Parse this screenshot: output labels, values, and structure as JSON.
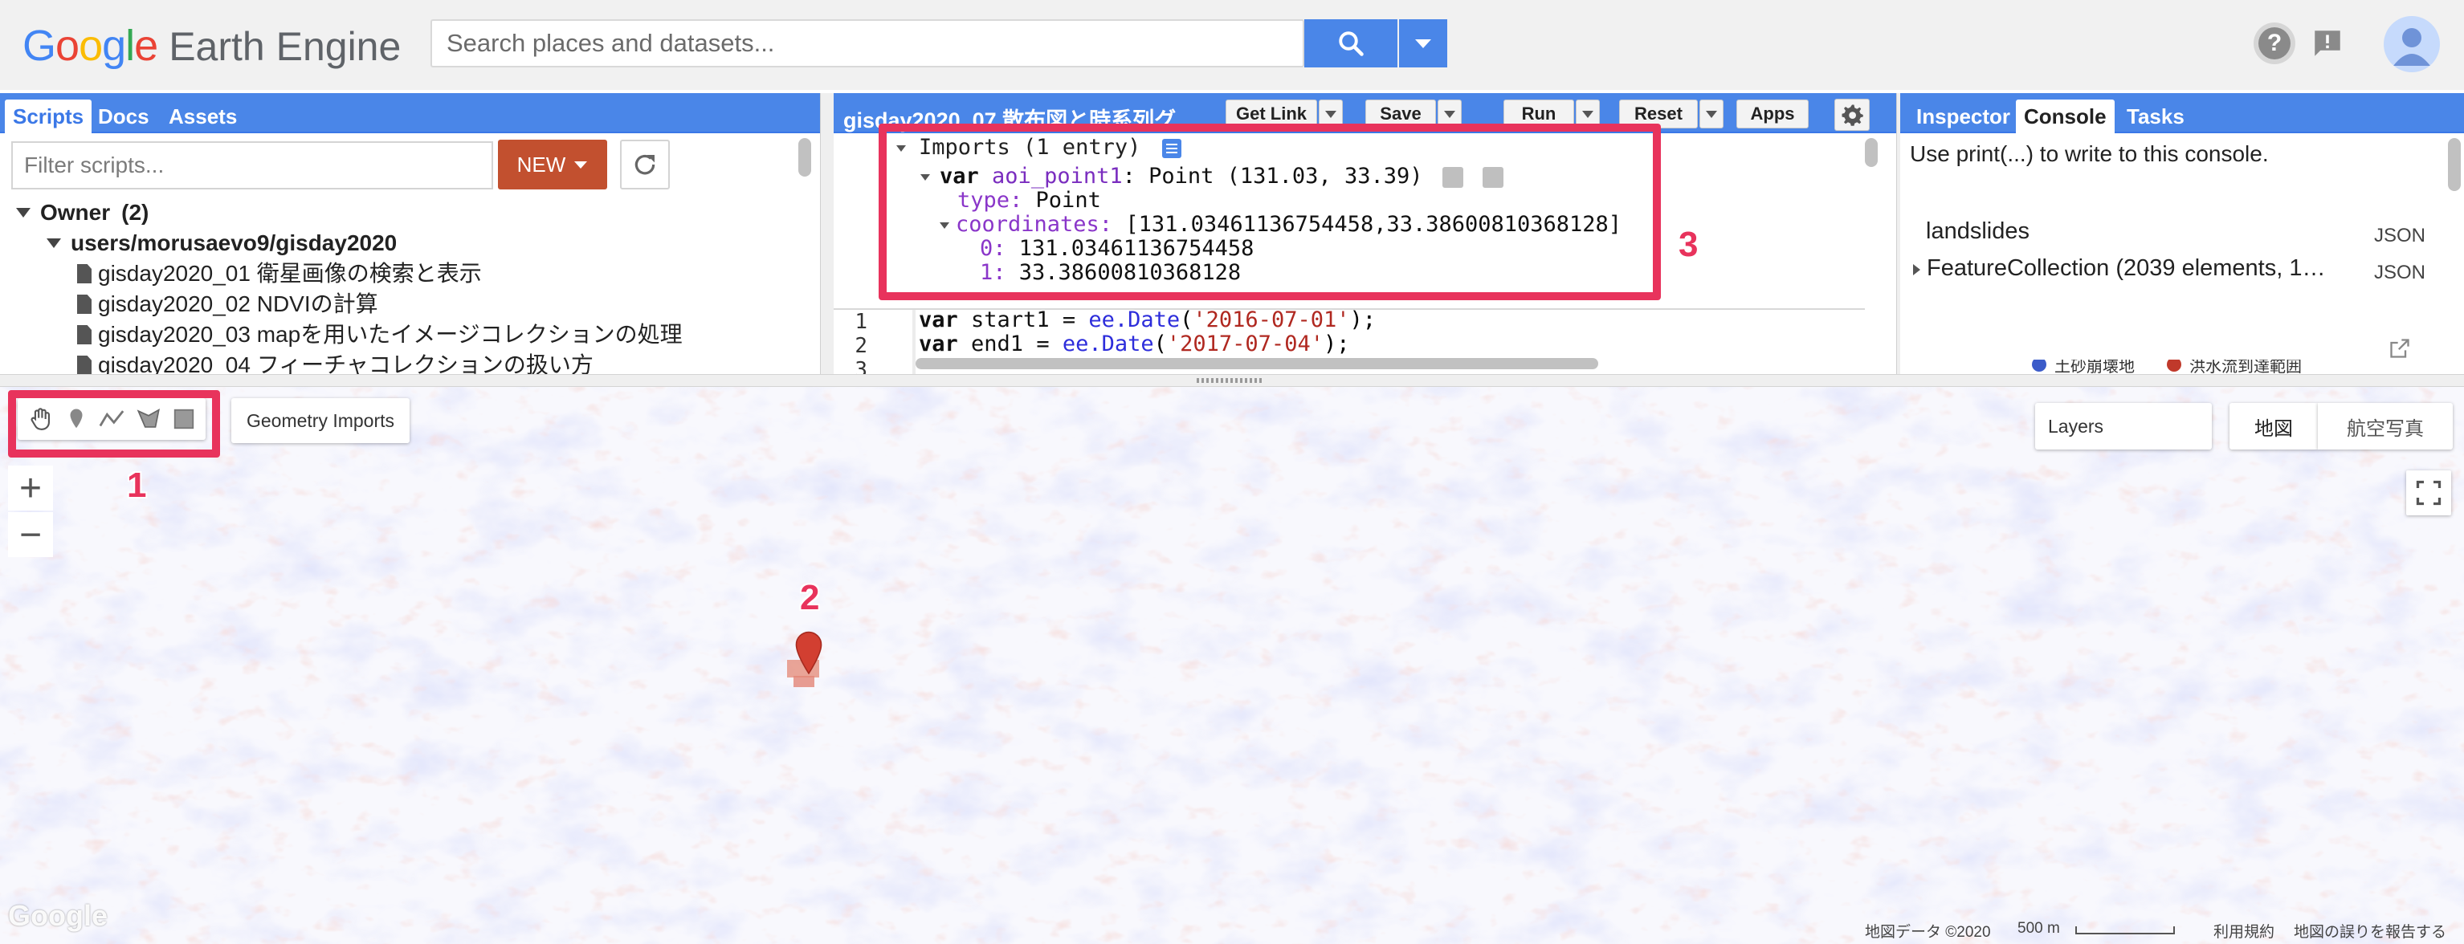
{
  "header": {
    "logo_google_letters": [
      "G",
      "o",
      "o",
      "g",
      "l",
      "e"
    ],
    "logo_google_colors": [
      "#4285f4",
      "#ea4335",
      "#fbbc05",
      "#4285f4",
      "#34a853",
      "#ea4335"
    ],
    "logo_product": "Earth Engine",
    "search_placeholder": "Search places and datasets...",
    "accent_color": "#4a86e8"
  },
  "left_panel": {
    "tabs": [
      "Scripts",
      "Docs",
      "Assets"
    ],
    "active_tab": "Scripts",
    "filter_placeholder": "Filter scripts...",
    "new_label": "NEW",
    "tree": {
      "owner_label": "Owner",
      "owner_count": "(2)",
      "repo": "users/morusaevo9/gisday2020",
      "files": [
        "gisday2020_01 衛星画像の検索と表示",
        "gisday2020_02 NDVIの計算",
        "gisday2020_03 mapを用いたイメージコレクションの処理",
        "gisday2020_04 フィーチャコレクションの扱い方"
      ]
    }
  },
  "editor": {
    "title": "gisday2020_07 散布図と時系列グ",
    "buttons": {
      "get_link": "Get Link",
      "save": "Save",
      "run": "Run",
      "reset": "Reset",
      "apps": "Apps"
    },
    "imports": {
      "header": "Imports (1 entry)",
      "var_kw": "var",
      "var_name": "aoi_point1",
      "var_desc": ": Point (131.03, 33.39)",
      "type_key": "type:",
      "type_val": "Point",
      "coords_key": "coordinates:",
      "coords_val": "[131.03461136754458,33.38600810368128]",
      "idx0_key": "0:",
      "idx0_val": "131.03461136754458",
      "idx1_key": "1:",
      "idx1_val": "33.38600810368128"
    },
    "line_numbers": [
      "1",
      "2",
      "3"
    ],
    "code": {
      "l1_var": "var",
      "l1_name": " start1 = ",
      "l1_fn": "ee.Date",
      "l1_open": "(",
      "l1_str": "'2016-07-01'",
      "l1_close": ");",
      "l2_var": "var",
      "l2_name": " end1 = ",
      "l2_fn": "ee.Date",
      "l2_open": "(",
      "l2_str": "'2017-07-04'",
      "l2_close": ");"
    }
  },
  "right_panel": {
    "tabs": [
      "Inspector",
      "Console",
      "Tasks"
    ],
    "active_tab": "Console",
    "hint": "Use print(...) to write to this console.",
    "rows": [
      {
        "label": "landslides",
        "tag": "JSON"
      },
      {
        "label": "FeatureCollection (2039 elements, 1…",
        "tag": "JSON"
      }
    ],
    "legend": [
      {
        "label": "土砂崩壊地",
        "color": "#3b5bc9"
      },
      {
        "label": "洪水流到達範囲",
        "color": "#c0392b"
      }
    ]
  },
  "map": {
    "geometry_imports_label": "Geometry Imports",
    "zoom_in": "+",
    "zoom_out": "−",
    "layers_label": "Layers",
    "map_type_map": "地図",
    "map_type_satellite": "航空写真",
    "attribution": "地図データ ©2020",
    "scale_label": "500 m",
    "terms": "利用規約",
    "report": "地図の誤りを報告する",
    "watermark": "Google"
  },
  "annotations": {
    "box1_num": "1",
    "box2_num": "2",
    "box3_num": "3",
    "color": "#e8335c"
  }
}
